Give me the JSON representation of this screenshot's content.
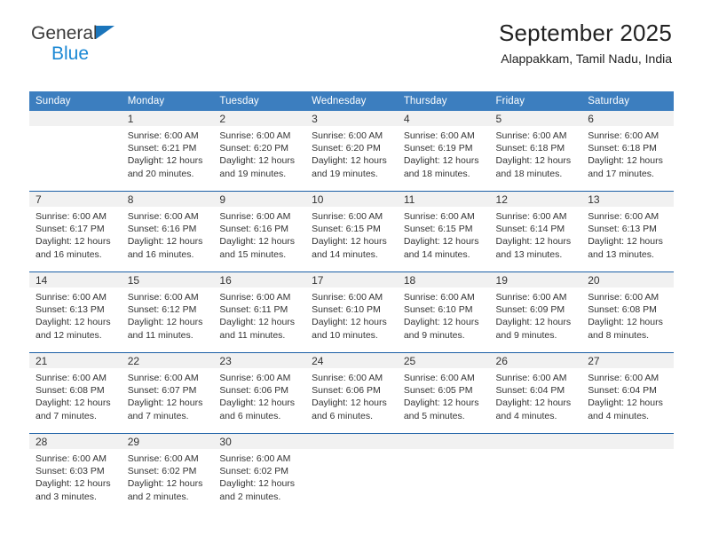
{
  "brand": {
    "word1": "General",
    "word2": "Blue",
    "triangle_color": "#1b75bb",
    "word2_color": "#1b88d4"
  },
  "header": {
    "title": "September 2025",
    "subtitle": "Alappakkam, Tamil Nadu, India"
  },
  "theme": {
    "header_row_bg": "#3c7ebf",
    "row_separator": "#1b5fa6",
    "daynum_bg": "#f1f1f1",
    "text": "#333333"
  },
  "weekday_headers": [
    "Sunday",
    "Monday",
    "Tuesday",
    "Wednesday",
    "Thursday",
    "Friday",
    "Saturday"
  ],
  "weeks": [
    [
      {
        "day": "",
        "sunrise": "",
        "sunset": "",
        "daylight1": "",
        "daylight2": "",
        "state": "empty"
      },
      {
        "day": "1",
        "sunrise": "Sunrise: 6:00 AM",
        "sunset": "Sunset: 6:21 PM",
        "daylight1": "Daylight: 12 hours",
        "daylight2": "and 20 minutes.",
        "state": "filled"
      },
      {
        "day": "2",
        "sunrise": "Sunrise: 6:00 AM",
        "sunset": "Sunset: 6:20 PM",
        "daylight1": "Daylight: 12 hours",
        "daylight2": "and 19 minutes.",
        "state": "filled"
      },
      {
        "day": "3",
        "sunrise": "Sunrise: 6:00 AM",
        "sunset": "Sunset: 6:20 PM",
        "daylight1": "Daylight: 12 hours",
        "daylight2": "and 19 minutes.",
        "state": "filled"
      },
      {
        "day": "4",
        "sunrise": "Sunrise: 6:00 AM",
        "sunset": "Sunset: 6:19 PM",
        "daylight1": "Daylight: 12 hours",
        "daylight2": "and 18 minutes.",
        "state": "filled"
      },
      {
        "day": "5",
        "sunrise": "Sunrise: 6:00 AM",
        "sunset": "Sunset: 6:18 PM",
        "daylight1": "Daylight: 12 hours",
        "daylight2": "and 18 minutes.",
        "state": "filled"
      },
      {
        "day": "6",
        "sunrise": "Sunrise: 6:00 AM",
        "sunset": "Sunset: 6:18 PM",
        "daylight1": "Daylight: 12 hours",
        "daylight2": "and 17 minutes.",
        "state": "filled"
      }
    ],
    [
      {
        "day": "7",
        "sunrise": "Sunrise: 6:00 AM",
        "sunset": "Sunset: 6:17 PM",
        "daylight1": "Daylight: 12 hours",
        "daylight2": "and 16 minutes.",
        "state": "filled"
      },
      {
        "day": "8",
        "sunrise": "Sunrise: 6:00 AM",
        "sunset": "Sunset: 6:16 PM",
        "daylight1": "Daylight: 12 hours",
        "daylight2": "and 16 minutes.",
        "state": "filled"
      },
      {
        "day": "9",
        "sunrise": "Sunrise: 6:00 AM",
        "sunset": "Sunset: 6:16 PM",
        "daylight1": "Daylight: 12 hours",
        "daylight2": "and 15 minutes.",
        "state": "filled"
      },
      {
        "day": "10",
        "sunrise": "Sunrise: 6:00 AM",
        "sunset": "Sunset: 6:15 PM",
        "daylight1": "Daylight: 12 hours",
        "daylight2": "and 14 minutes.",
        "state": "filled"
      },
      {
        "day": "11",
        "sunrise": "Sunrise: 6:00 AM",
        "sunset": "Sunset: 6:15 PM",
        "daylight1": "Daylight: 12 hours",
        "daylight2": "and 14 minutes.",
        "state": "filled"
      },
      {
        "day": "12",
        "sunrise": "Sunrise: 6:00 AM",
        "sunset": "Sunset: 6:14 PM",
        "daylight1": "Daylight: 12 hours",
        "daylight2": "and 13 minutes.",
        "state": "filled"
      },
      {
        "day": "13",
        "sunrise": "Sunrise: 6:00 AM",
        "sunset": "Sunset: 6:13 PM",
        "daylight1": "Daylight: 12 hours",
        "daylight2": "and 13 minutes.",
        "state": "filled"
      }
    ],
    [
      {
        "day": "14",
        "sunrise": "Sunrise: 6:00 AM",
        "sunset": "Sunset: 6:13 PM",
        "daylight1": "Daylight: 12 hours",
        "daylight2": "and 12 minutes.",
        "state": "filled"
      },
      {
        "day": "15",
        "sunrise": "Sunrise: 6:00 AM",
        "sunset": "Sunset: 6:12 PM",
        "daylight1": "Daylight: 12 hours",
        "daylight2": "and 11 minutes.",
        "state": "filled"
      },
      {
        "day": "16",
        "sunrise": "Sunrise: 6:00 AM",
        "sunset": "Sunset: 6:11 PM",
        "daylight1": "Daylight: 12 hours",
        "daylight2": "and 11 minutes.",
        "state": "filled"
      },
      {
        "day": "17",
        "sunrise": "Sunrise: 6:00 AM",
        "sunset": "Sunset: 6:10 PM",
        "daylight1": "Daylight: 12 hours",
        "daylight2": "and 10 minutes.",
        "state": "filled"
      },
      {
        "day": "18",
        "sunrise": "Sunrise: 6:00 AM",
        "sunset": "Sunset: 6:10 PM",
        "daylight1": "Daylight: 12 hours",
        "daylight2": "and 9 minutes.",
        "state": "filled"
      },
      {
        "day": "19",
        "sunrise": "Sunrise: 6:00 AM",
        "sunset": "Sunset: 6:09 PM",
        "daylight1": "Daylight: 12 hours",
        "daylight2": "and 9 minutes.",
        "state": "filled"
      },
      {
        "day": "20",
        "sunrise": "Sunrise: 6:00 AM",
        "sunset": "Sunset: 6:08 PM",
        "daylight1": "Daylight: 12 hours",
        "daylight2": "and 8 minutes.",
        "state": "filled"
      }
    ],
    [
      {
        "day": "21",
        "sunrise": "Sunrise: 6:00 AM",
        "sunset": "Sunset: 6:08 PM",
        "daylight1": "Daylight: 12 hours",
        "daylight2": "and 7 minutes.",
        "state": "filled"
      },
      {
        "day": "22",
        "sunrise": "Sunrise: 6:00 AM",
        "sunset": "Sunset: 6:07 PM",
        "daylight1": "Daylight: 12 hours",
        "daylight2": "and 7 minutes.",
        "state": "filled"
      },
      {
        "day": "23",
        "sunrise": "Sunrise: 6:00 AM",
        "sunset": "Sunset: 6:06 PM",
        "daylight1": "Daylight: 12 hours",
        "daylight2": "and 6 minutes.",
        "state": "filled"
      },
      {
        "day": "24",
        "sunrise": "Sunrise: 6:00 AM",
        "sunset": "Sunset: 6:06 PM",
        "daylight1": "Daylight: 12 hours",
        "daylight2": "and 6 minutes.",
        "state": "filled"
      },
      {
        "day": "25",
        "sunrise": "Sunrise: 6:00 AM",
        "sunset": "Sunset: 6:05 PM",
        "daylight1": "Daylight: 12 hours",
        "daylight2": "and 5 minutes.",
        "state": "filled"
      },
      {
        "day": "26",
        "sunrise": "Sunrise: 6:00 AM",
        "sunset": "Sunset: 6:04 PM",
        "daylight1": "Daylight: 12 hours",
        "daylight2": "and 4 minutes.",
        "state": "filled"
      },
      {
        "day": "27",
        "sunrise": "Sunrise: 6:00 AM",
        "sunset": "Sunset: 6:04 PM",
        "daylight1": "Daylight: 12 hours",
        "daylight2": "and 4 minutes.",
        "state": "filled"
      }
    ],
    [
      {
        "day": "28",
        "sunrise": "Sunrise: 6:00 AM",
        "sunset": "Sunset: 6:03 PM",
        "daylight1": "Daylight: 12 hours",
        "daylight2": "and 3 minutes.",
        "state": "filled"
      },
      {
        "day": "29",
        "sunrise": "Sunrise: 6:00 AM",
        "sunset": "Sunset: 6:02 PM",
        "daylight1": "Daylight: 12 hours",
        "daylight2": "and 2 minutes.",
        "state": "filled"
      },
      {
        "day": "30",
        "sunrise": "Sunrise: 6:00 AM",
        "sunset": "Sunset: 6:02 PM",
        "daylight1": "Daylight: 12 hours",
        "daylight2": "and 2 minutes.",
        "state": "filled"
      },
      {
        "day": "",
        "sunrise": "",
        "sunset": "",
        "daylight1": "",
        "daylight2": "",
        "state": "empty"
      },
      {
        "day": "",
        "sunrise": "",
        "sunset": "",
        "daylight1": "",
        "daylight2": "",
        "state": "empty"
      },
      {
        "day": "",
        "sunrise": "",
        "sunset": "",
        "daylight1": "",
        "daylight2": "",
        "state": "empty"
      },
      {
        "day": "",
        "sunrise": "",
        "sunset": "",
        "daylight1": "",
        "daylight2": "",
        "state": "empty"
      }
    ]
  ]
}
